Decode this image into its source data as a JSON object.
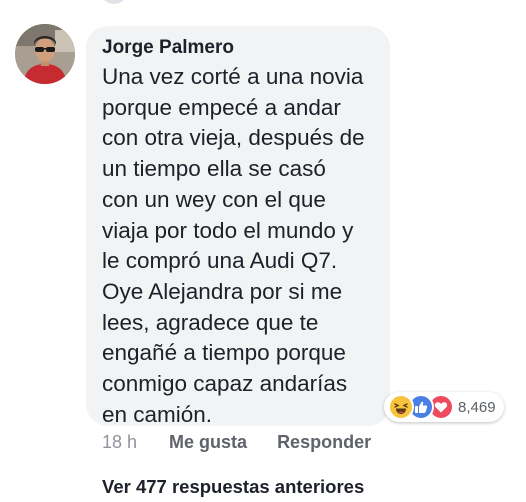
{
  "comment": {
    "author": "Jorge Palmero",
    "text_lines": [
      "Una vez corté a una novia",
      "porque empecé a andar",
      "con otra vieja, después de",
      "un tiempo ella se casó",
      "con un wey con el que",
      "viaja por todo el mundo y",
      "le compró una Audi Q7.",
      "Oye Alejandra por si me",
      "lees, agradece que te",
      "engañé a tiempo porque",
      "conmigo capaz andarías",
      "en camión."
    ],
    "reactions": {
      "icons": [
        "haha-icon",
        "like-icon",
        "love-icon"
      ],
      "count": "8,469",
      "colors": {
        "haha": "#f7c33d",
        "like": "#4a7fe4",
        "love": "#ee4b5f"
      }
    },
    "timestamp": "18 h",
    "like_label": "Me gusta",
    "reply_label": "Responder"
  },
  "replies": {
    "view_previous_label": "Ver 477 respuestas anteriores"
  },
  "colors": {
    "bubble_background": "#f2f3f5",
    "text": "#1d2129",
    "meta_text": "#90949c"
  }
}
